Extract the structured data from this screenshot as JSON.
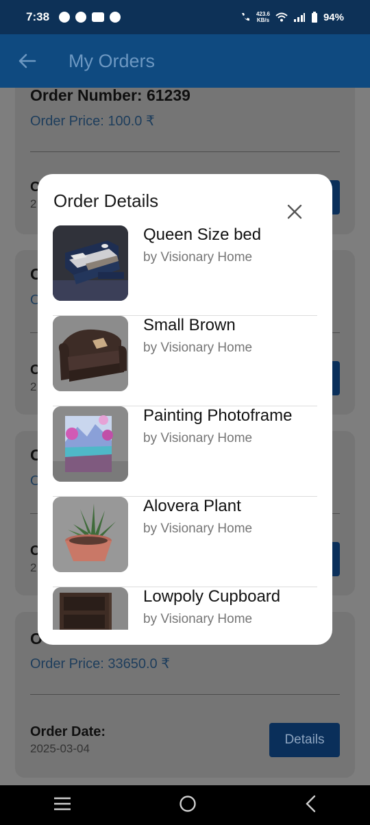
{
  "status_bar": {
    "time": "7:38",
    "net_speed_value": "423.6",
    "net_speed_unit": "KB/s",
    "battery": "94%"
  },
  "app_bar": {
    "title": "My Orders",
    "back_icon": "arrow-left-icon"
  },
  "orders": [
    {
      "number_label": "Order Number: 61239",
      "price_label": "Order Price: 100.0 ₹",
      "date_label": "O",
      "date_value": "2",
      "details_label": ""
    },
    {
      "number_label": "O",
      "price_label": "O",
      "date_label": "O",
      "date_value": "2",
      "details_label": ""
    },
    {
      "number_label": "O",
      "price_label": "O",
      "date_label": "O",
      "date_value": "2",
      "details_label": ""
    },
    {
      "number_label": "O",
      "price_label": "Order Price: 33650.0 ₹",
      "date_label": "Order Date:",
      "date_value": "2025-03-04",
      "details_label": "Details"
    }
  ],
  "modal": {
    "title": "Order Details",
    "close_icon": "close-icon",
    "items": [
      {
        "name": "Queen Size bed",
        "vendor": "by Visionary Home",
        "icon": "bed-thumbnail"
      },
      {
        "name": "Small Brown",
        "vendor": "by Visionary Home",
        "icon": "sofa-thumbnail"
      },
      {
        "name": "Painting Photoframe",
        "vendor": "by Visionary Home",
        "icon": "painting-thumbnail"
      },
      {
        "name": "Alovera Plant",
        "vendor": "by Visionary Home",
        "icon": "plant-thumbnail"
      },
      {
        "name": "Lowpoly Cupboard",
        "vendor": "by Visionary Home",
        "icon": "cupboard-thumbnail"
      }
    ]
  },
  "nav_bar": {
    "recents_icon": "menu-icon",
    "home_icon": "home-circle-icon",
    "back_icon": "back-chevron-icon"
  },
  "colors": {
    "primary": "#0f4a80",
    "status_bar": "#0d3157",
    "button": "#0a2f5a",
    "overlay": "#7e7e7e"
  }
}
